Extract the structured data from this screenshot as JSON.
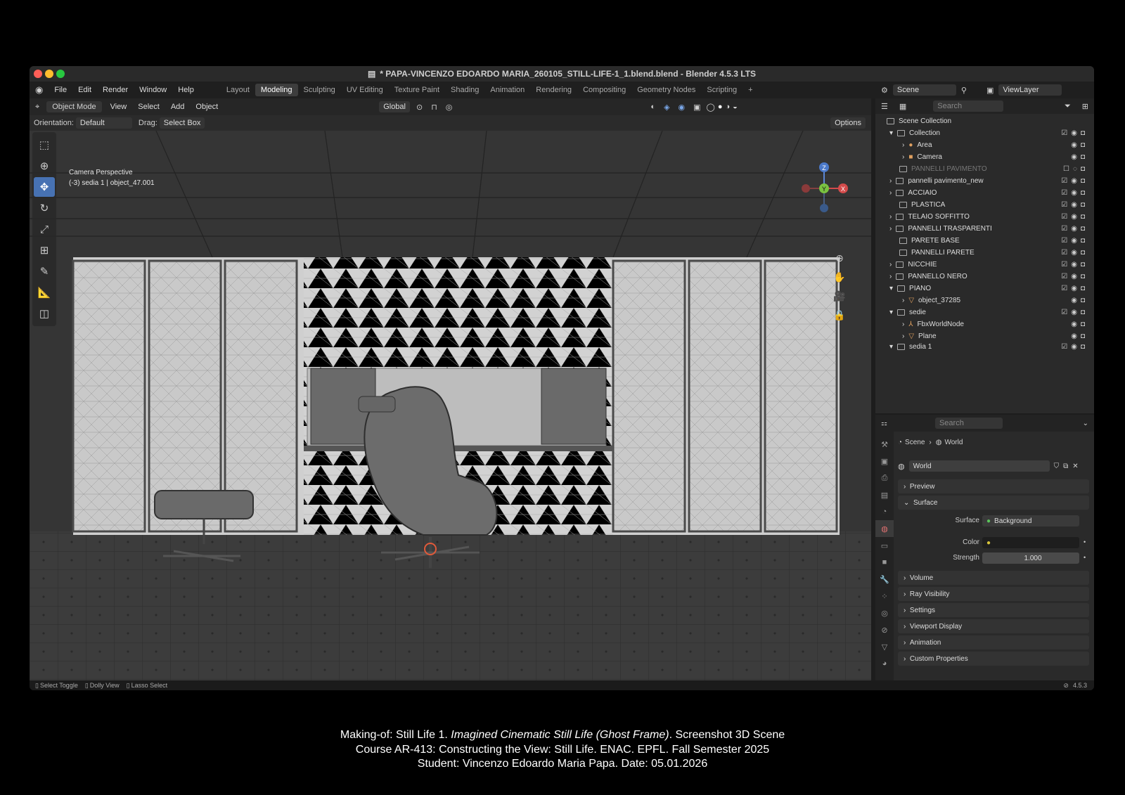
{
  "window": {
    "title": "* PAPA-VINCENZO EDOARDO MARIA_260105_STILL-LIFE-1_1.blend.blend - Blender 4.5.3 LTS"
  },
  "menu": [
    "File",
    "Edit",
    "Render",
    "Window",
    "Help"
  ],
  "workspaces": [
    "Layout",
    "Modeling",
    "Sculpting",
    "UV Editing",
    "Texture Paint",
    "Shading",
    "Animation",
    "Rendering",
    "Compositing",
    "Geometry Nodes",
    "Scripting"
  ],
  "active_workspace": "Modeling",
  "scene_bar": {
    "scene": "Scene",
    "view_layer": "ViewLayer"
  },
  "viewport": {
    "mode": "Object Mode",
    "menus": [
      "View",
      "Select",
      "Add",
      "Object"
    ],
    "transform": "Global",
    "orientation_label": "Orientation:",
    "orientation_value": "Default",
    "drag_label": "Drag:",
    "drag_value": "Select Box",
    "options": "Options",
    "info_line1": "Camera Perspective",
    "info_line2": "(-3) sedia 1 | object_47.001",
    "gizmo": {
      "z": "Z",
      "y": "Y",
      "x": "X"
    }
  },
  "outliner": {
    "search_placeholder": "Search",
    "root": "Scene Collection",
    "rows": [
      "Collection",
      "Area",
      "Camera",
      "PANNELLI PAVIMENTO",
      "pannelli pavimento_new",
      "ACCIAIO",
      "PLASTICA",
      "TELAIO SOFFITTO",
      "PANNELLI TRASPARENTI",
      "PARETE BASE",
      "PANNELLI PARETE",
      "NICCHIE",
      "PANNELLO NERO",
      "PIANO",
      "object_37285",
      "sedie",
      "FbxWorldNode",
      "Plane",
      "sedia 1"
    ]
  },
  "properties": {
    "search_placeholder": "Search",
    "breadcrumb_scene": "Scene",
    "breadcrumb_world": "World",
    "world_name": "World",
    "panels": {
      "preview": "Preview",
      "surface": "Surface",
      "volume": "Volume",
      "ray_visibility": "Ray Visibility",
      "settings": "Settings",
      "viewport_display": "Viewport Display",
      "animation": "Animation",
      "custom_properties": "Custom Properties"
    },
    "surface_label": "Surface",
    "surface_value": "Background",
    "color_label": "Color",
    "strength_label": "Strength",
    "strength_value": "1.000"
  },
  "status": {
    "left1": "Select Toggle",
    "left2": "Dolly View",
    "left3": "Lasso Select",
    "version": "4.5.3"
  },
  "caption": {
    "line1_a": "Making-of: Still Life 1. ",
    "line1_b": "Imagined Cinematic Still Life (Ghost Frame)",
    "line1_c": ". Screenshot 3D Scene",
    "line2": "Course AR-413: Constructing the View: Still Life. ENAC. EPFL. Fall Semester 2025",
    "line3": "Student: Vincenzo Edoardo Maria Papa. Date: 05.01.2026"
  },
  "colors": {
    "accent": "#4772b3",
    "background": "#000000",
    "ui": "#2a2a2a"
  }
}
